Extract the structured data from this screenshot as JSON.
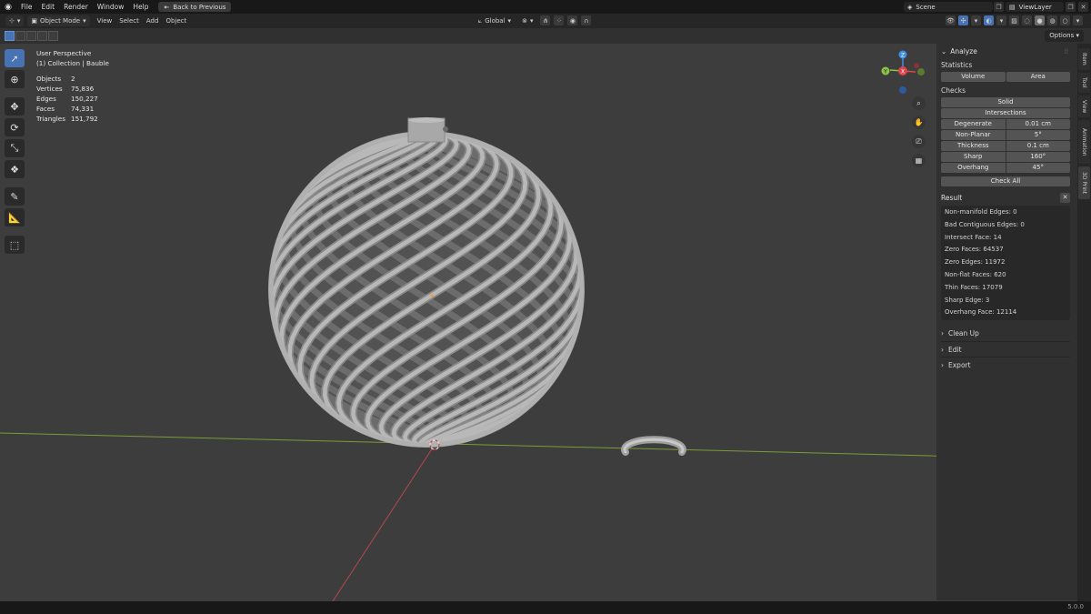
{
  "menubar": {
    "items": [
      "File",
      "Edit",
      "Render",
      "Window",
      "Help"
    ],
    "back_button": "Back to Previous",
    "scene": "Scene",
    "view_layer": "ViewLayer"
  },
  "header": {
    "mode": "Object Mode",
    "menus": [
      "View",
      "Select",
      "Add",
      "Object"
    ],
    "transform_orientation": "Global"
  },
  "options_label": "Options",
  "viewport": {
    "view_name": "User Perspective",
    "collection": "(1) Collection | Bauble",
    "stats": [
      {
        "label": "Objects",
        "value": "2"
      },
      {
        "label": "Vertices",
        "value": "75,836"
      },
      {
        "label": "Edges",
        "value": "150,227"
      },
      {
        "label": "Faces",
        "value": "74,331"
      },
      {
        "label": "Triangles",
        "value": "151,792"
      }
    ],
    "gizmo": {
      "z": "Z",
      "y": "Y",
      "x": "X"
    }
  },
  "npanel": {
    "title": "Analyze",
    "statistics_label": "Statistics",
    "volume_btn": "Volume",
    "area_btn": "Area",
    "checks_label": "Checks",
    "solid_btn": "Solid",
    "intersections_btn": "Intersections",
    "checks": [
      {
        "label": "Degenerate",
        "value": "0.01 cm"
      },
      {
        "label": "Non-Planar",
        "value": "5°"
      },
      {
        "label": "Thickness",
        "value": "0.1 cm"
      },
      {
        "label": "Sharp",
        "value": "160°"
      },
      {
        "label": "Overhang",
        "value": "45°"
      }
    ],
    "check_all_btn": "Check All",
    "result_label": "Result",
    "results": [
      "Non-manifold Edges: 0",
      "Bad Contiguous Edges: 0",
      "Intersect Face: 14",
      "Zero Faces: 64537",
      "Zero Edges: 11972",
      "Non-flat Faces: 620",
      "Thin Faces: 17079",
      "Sharp Edge: 3",
      "Overhang Face: 12114"
    ],
    "sections": [
      "Clean Up",
      "Edit",
      "Export"
    ]
  },
  "vtabs": [
    "Item",
    "Tool",
    "View",
    "Animation",
    "3D Print"
  ],
  "version": "5.0.0",
  "colors": {
    "accent": "#4772b3",
    "x_axis": "#e0444f",
    "y_axis": "#8bc34a",
    "z_axis": "#3f8fe6"
  }
}
